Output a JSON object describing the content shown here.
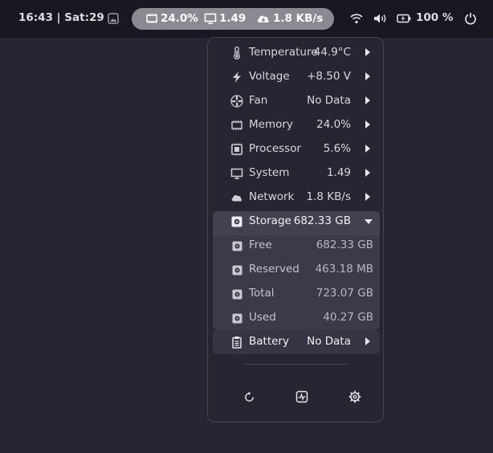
{
  "topbar": {
    "clock": "16:43 | Sat:29",
    "pill": {
      "memory": "24.0%",
      "system": "1.49",
      "network": "1.8 KB/s"
    },
    "battery_percent": "100 %"
  },
  "menu": {
    "items": [
      {
        "label": "Temperature",
        "value": "44.9°C",
        "icon": "thermometer-icon"
      },
      {
        "label": "Voltage",
        "value": "+8.50 V",
        "icon": "lightning-icon"
      },
      {
        "label": "Fan",
        "value": "No Data",
        "icon": "fan-icon"
      },
      {
        "label": "Memory",
        "value": "24.0%",
        "icon": "memory-icon"
      },
      {
        "label": "Processor",
        "value": "5.6%",
        "icon": "processor-icon"
      },
      {
        "label": "System",
        "value": "1.49",
        "icon": "monitor-icon"
      },
      {
        "label": "Network",
        "value": "1.8 KB/s",
        "icon": "cloud-icon"
      }
    ],
    "storage": {
      "label": "Storage",
      "value": "682.33 GB",
      "sub": [
        {
          "label": "Free",
          "value": "682.33 GB"
        },
        {
          "label": "Reserved",
          "value": "463.18 MB"
        },
        {
          "label": "Total",
          "value": "723.07 GB"
        },
        {
          "label": "Used",
          "value": "40.27 GB"
        }
      ]
    },
    "battery": {
      "label": "Battery",
      "value": "No Data"
    }
  },
  "colors": {
    "background": "#252535",
    "topbar": "#181822",
    "pill": "#8a8a92",
    "menu": "#262633",
    "storage_section": "#3a3a48"
  }
}
